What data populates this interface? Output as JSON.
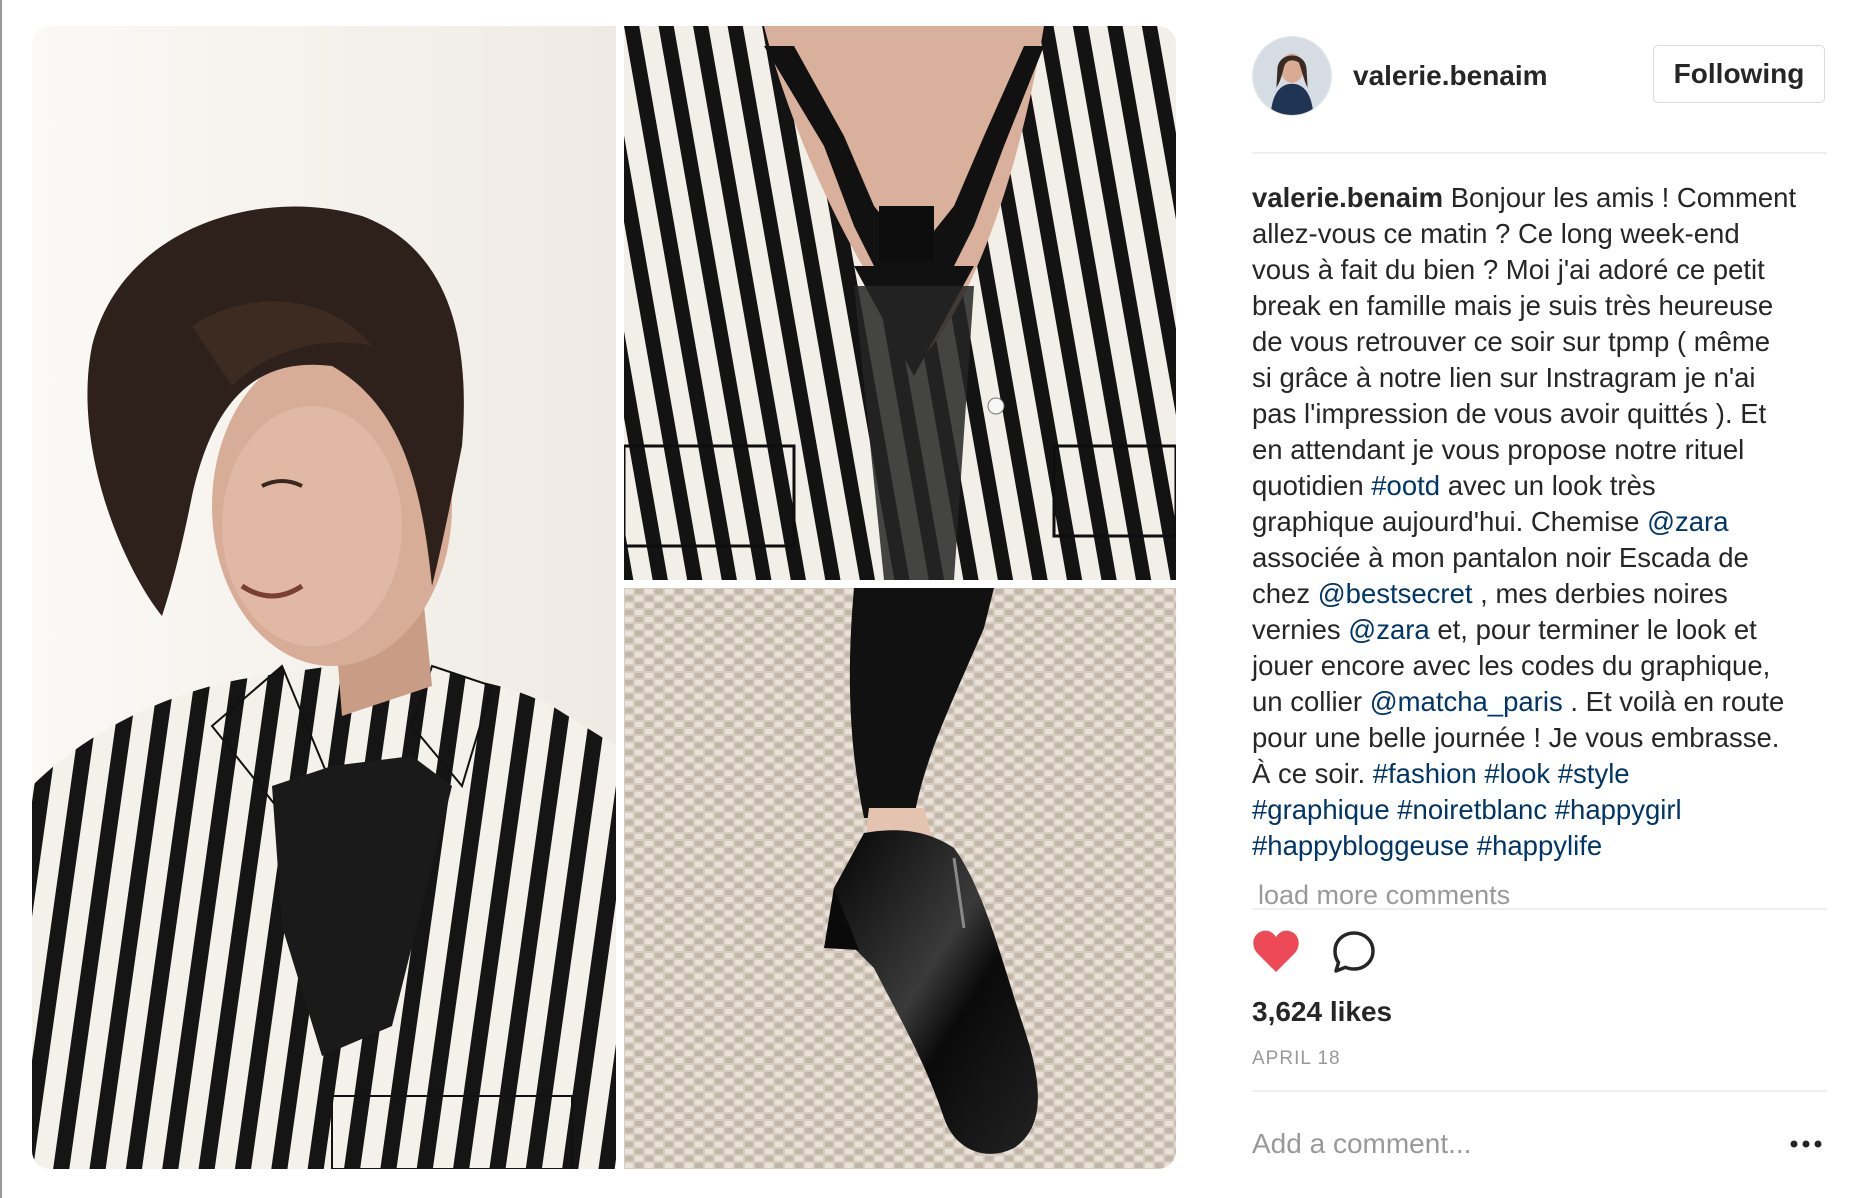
{
  "post": {
    "username": "valerie.benaim",
    "follow_label": "Following",
    "caption_lines": [
      [
        {
          "t": "user",
          "v": "valerie.benaim"
        },
        {
          "t": "text",
          "v": " Bonjour les amis ! Comment"
        }
      ],
      [
        {
          "t": "text",
          "v": "allez-vous ce matin ? Ce long week-end"
        }
      ],
      [
        {
          "t": "text",
          "v": "vous à fait du bien ? Moi j'ai adoré ce petit"
        }
      ],
      [
        {
          "t": "text",
          "v": "break en famille mais je suis très heureuse"
        }
      ],
      [
        {
          "t": "text",
          "v": "de vous retrouver ce soir sur tpmp ( même"
        }
      ],
      [
        {
          "t": "text",
          "v": "si grâce à notre lien sur Instragram je n'ai"
        }
      ],
      [
        {
          "t": "text",
          "v": "pas l'impression de vous avoir quittés ). Et"
        }
      ],
      [
        {
          "t": "text",
          "v": "en attendant je vous propose notre rituel"
        }
      ],
      [
        {
          "t": "text",
          "v": "quotidien "
        },
        {
          "t": "tag",
          "v": "#ootd"
        },
        {
          "t": "text",
          "v": " avec un look très"
        }
      ],
      [
        {
          "t": "text",
          "v": "graphique aujourd'hui. Chemise "
        },
        {
          "t": "tag",
          "v": "@zara"
        }
      ],
      [
        {
          "t": "text",
          "v": "associée à mon pantalon noir Escada de"
        }
      ],
      [
        {
          "t": "text",
          "v": "chez "
        },
        {
          "t": "tag",
          "v": "@bestsecret"
        },
        {
          "t": "text",
          "v": " , mes derbies noires"
        }
      ],
      [
        {
          "t": "text",
          "v": "vernies "
        },
        {
          "t": "tag",
          "v": "@zara"
        },
        {
          "t": "text",
          "v": " et, pour terminer le look et"
        }
      ],
      [
        {
          "t": "text",
          "v": "jouer encore avec les codes du graphique,"
        }
      ],
      [
        {
          "t": "text",
          "v": "un collier "
        },
        {
          "t": "tag",
          "v": "@matcha_paris"
        },
        {
          "t": "text",
          "v": " . Et voilà en route"
        }
      ],
      [
        {
          "t": "text",
          "v": "pour une belle journée ! Je vous embrasse."
        }
      ],
      [
        {
          "t": "text",
          "v": "À ce soir. "
        },
        {
          "t": "tag",
          "v": "#fashion"
        },
        {
          "t": "text",
          "v": " "
        },
        {
          "t": "tag",
          "v": "#look"
        },
        {
          "t": "text",
          "v": " "
        },
        {
          "t": "tag",
          "v": "#style"
        }
      ],
      [
        {
          "t": "tag",
          "v": "#graphique"
        },
        {
          "t": "text",
          "v": " "
        },
        {
          "t": "tag",
          "v": "#noiretblanc"
        },
        {
          "t": "text",
          "v": " "
        },
        {
          "t": "tag",
          "v": "#happygirl"
        }
      ],
      [
        {
          "t": "tag",
          "v": "#happybloggeuse"
        },
        {
          "t": "text",
          "v": " "
        },
        {
          "t": "tag",
          "v": "#happylife"
        }
      ]
    ],
    "load_more_label": "load more comments",
    "likes_label": "3,624 likes",
    "date_label": "APRIL 18",
    "comment_placeholder": "Add a comment...",
    "liked": true
  },
  "colors": {
    "heart": "#ed4956",
    "link": "#003569",
    "muted": "#999999",
    "text": "#262626"
  },
  "icons": {
    "like": "heart-icon",
    "comment": "speech-bubble-icon",
    "more": "ellipsis-icon"
  }
}
